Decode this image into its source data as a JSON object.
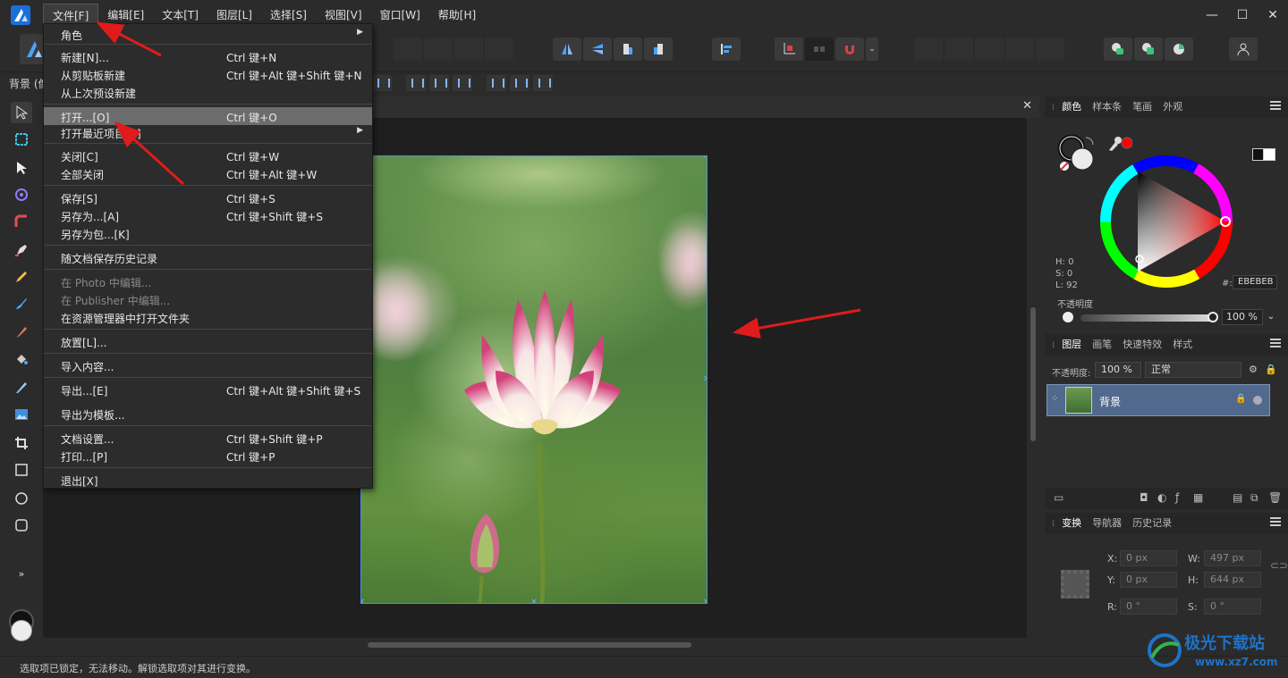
{
  "menubar": {
    "items": [
      "文件[F]",
      "编辑[E]",
      "文本[T]",
      "图层[L]",
      "选择[S]",
      "视图[V]",
      "窗口[W]",
      "帮助[H]"
    ],
    "active_index": 0,
    "window": {
      "minimize": "—",
      "maximize": "☐",
      "close": "✕"
    }
  },
  "context_bar": {
    "label": "背景 (像"
  },
  "file_menu": {
    "items": [
      {
        "label": "角色",
        "shortcut": "",
        "submenu": true,
        "disabled": false,
        "highlighted": false
      },
      {
        "label": "新建[N]...",
        "shortcut": "Ctrl 键+N",
        "submenu": false,
        "disabled": false,
        "highlighted": false
      },
      {
        "label": "从剪贴板新建",
        "shortcut": "Ctrl 键+Alt 键+Shift 键+N",
        "submenu": false,
        "disabled": false,
        "highlighted": false
      },
      {
        "label": "从上次预设新建",
        "shortcut": "",
        "submenu": false,
        "disabled": false,
        "highlighted": false
      },
      {
        "label": "打开...[O]",
        "shortcut": "Ctrl 键+O",
        "submenu": false,
        "disabled": false,
        "highlighted": true
      },
      {
        "label": "打开最近项目[R]",
        "shortcut": "",
        "submenu": true,
        "disabled": false,
        "highlighted": false
      },
      {
        "label": "关闭[C]",
        "shortcut": "Ctrl 键+W",
        "submenu": false,
        "disabled": false,
        "highlighted": false
      },
      {
        "label": "全部关闭",
        "shortcut": "Ctrl 键+Alt 键+W",
        "submenu": false,
        "disabled": false,
        "highlighted": false
      },
      {
        "label": "保存[S]",
        "shortcut": "Ctrl 键+S",
        "submenu": false,
        "disabled": false,
        "highlighted": false
      },
      {
        "label": "另存为...[A]",
        "shortcut": "Ctrl 键+Shift 键+S",
        "submenu": false,
        "disabled": false,
        "highlighted": false
      },
      {
        "label": "另存为包...[K]",
        "shortcut": "",
        "submenu": false,
        "disabled": false,
        "highlighted": false
      },
      {
        "label": "随文档保存历史记录",
        "shortcut": "",
        "submenu": false,
        "disabled": false,
        "highlighted": false
      },
      {
        "label": "在 Photo 中编辑...",
        "shortcut": "",
        "submenu": false,
        "disabled": true,
        "highlighted": false
      },
      {
        "label": "在 Publisher 中编辑...",
        "shortcut": "",
        "submenu": false,
        "disabled": true,
        "highlighted": false
      },
      {
        "label": "在资源管理器中打开文件夹",
        "shortcut": "",
        "submenu": false,
        "disabled": false,
        "highlighted": false
      },
      {
        "label": "放置[L]...",
        "shortcut": "",
        "submenu": false,
        "disabled": false,
        "highlighted": false
      },
      {
        "label": "导入内容...",
        "shortcut": "",
        "submenu": false,
        "disabled": false,
        "highlighted": false
      },
      {
        "label": "导出...[E]",
        "shortcut": "Ctrl 键+Alt 键+Shift 键+S",
        "submenu": false,
        "disabled": false,
        "highlighted": false
      },
      {
        "label": "导出为模板...",
        "shortcut": "",
        "submenu": false,
        "disabled": false,
        "highlighted": false
      },
      {
        "label": "文档设置...",
        "shortcut": "Ctrl 键+Shift 键+P",
        "submenu": false,
        "disabled": false,
        "highlighted": false
      },
      {
        "label": "打印...[P]",
        "shortcut": "Ctrl 键+P",
        "submenu": false,
        "disabled": false,
        "highlighted": false
      },
      {
        "label": "退出[X]",
        "shortcut": "",
        "submenu": false,
        "disabled": false,
        "highlighted": false
      }
    ]
  },
  "color_panel": {
    "tabs": [
      "颜色",
      "样本条",
      "笔画",
      "外观"
    ],
    "h": "H: 0",
    "s": "S: 0",
    "l": "L: 92",
    "hex_label": "#:",
    "hex_value": "EBEBEB",
    "opacity_label": "不透明度",
    "opacity_value": "100 %",
    "fill_color": "#EBEBEB",
    "picker_color": "#ff0000"
  },
  "layers_panel": {
    "tabs": [
      "图层",
      "画笔",
      "快速特效",
      "样式"
    ],
    "opacity_label": "不透明度:",
    "opacity_value": "100 %",
    "blend_mode": "正常",
    "layers": [
      {
        "name": "背景"
      }
    ]
  },
  "transform_panel": {
    "tabs": [
      "变换",
      "导航器",
      "历史记录"
    ],
    "x_label": "X:",
    "x_value": "0 px",
    "y_label": "Y:",
    "y_value": "0 px",
    "w_label": "W:",
    "w_value": "497 px",
    "h_label": "H:",
    "h_value": "644 px",
    "r_label": "R:",
    "r_value": "0 °",
    "s_label": "S:",
    "s_value": "0 °"
  },
  "status_bar": {
    "text": "选取项已锁定，无法移动。解锁选取项对其进行变换。"
  },
  "watermark": {
    "title": "极光下载站",
    "url": "www.xz7.com"
  },
  "colors": {
    "accent": "#4a90e2",
    "selected_layer": "#51698d",
    "annotation_arrow": "#e01b1b"
  }
}
